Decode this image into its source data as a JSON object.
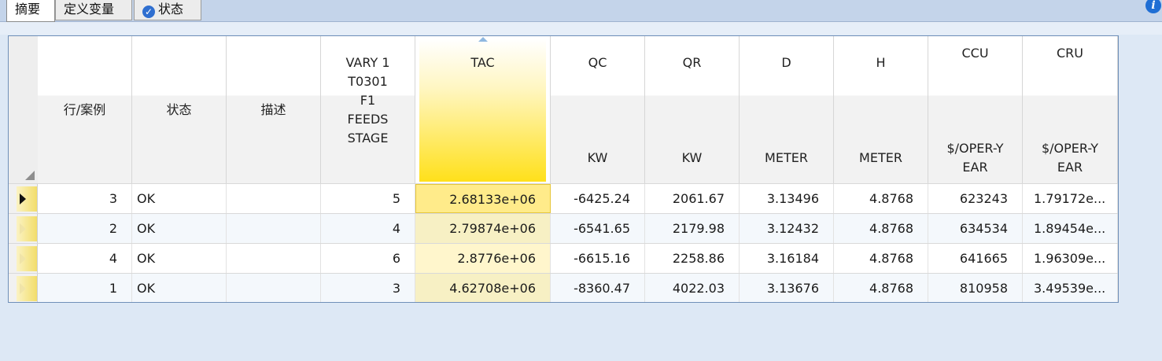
{
  "tabs": [
    {
      "label": "摘要",
      "active": true
    },
    {
      "label": "定义变量",
      "active": false
    },
    {
      "label": "状态",
      "active": false,
      "icon": "check-circle-icon"
    }
  ],
  "info_icon": "info-icon",
  "accent": {
    "tac_highlight": "#ffe01a",
    "border": "#6f8fb8",
    "tab_bg": "#c4d4ea"
  },
  "grid": {
    "columns": {
      "row_case": {
        "label": "行/案例"
      },
      "status": {
        "label": "状态"
      },
      "description": {
        "label": "描述"
      },
      "vary": {
        "lines": [
          "VARY   1",
          "T0301",
          "F1",
          "FEEDS",
          "STAGE"
        ]
      },
      "tac": {
        "label": "TAC",
        "unit": ""
      },
      "qc": {
        "label": "QC",
        "unit": "KW"
      },
      "qr": {
        "label": "QR",
        "unit": "KW"
      },
      "d": {
        "label": "D",
        "unit": "METER"
      },
      "h": {
        "label": "H",
        "unit": "METER"
      },
      "ccu": {
        "label": "CCU",
        "unit_lines": [
          "$/OPER-Y",
          "EAR"
        ]
      },
      "cru": {
        "label": "CRU",
        "unit_lines": [
          "$/OPER-Y",
          "EAR"
        ]
      }
    },
    "rows": [
      {
        "case": "3",
        "status": "OK",
        "desc": "",
        "vary": "5",
        "tac": "2.68133e+06",
        "qc": "-6425.24",
        "qr": "2061.67",
        "d": "3.13496",
        "h": "4.8768",
        "ccu": "623243",
        "cru": "1.79172e..."
      },
      {
        "case": "2",
        "status": "OK",
        "desc": "",
        "vary": "4",
        "tac": "2.79874e+06",
        "qc": "-6541.65",
        "qr": "2179.98",
        "d": "3.12432",
        "h": "4.8768",
        "ccu": "634534",
        "cru": "1.89454e..."
      },
      {
        "case": "4",
        "status": "OK",
        "desc": "",
        "vary": "6",
        "tac": "2.8776e+06",
        "qc": "-6615.16",
        "qr": "2258.86",
        "d": "3.16184",
        "h": "4.8768",
        "ccu": "641665",
        "cru": "1.96309e..."
      },
      {
        "case": "1",
        "status": "OK",
        "desc": "",
        "vary": "3",
        "tac": "4.62708e+06",
        "qc": "-8360.47",
        "qr": "4022.03",
        "d": "3.13676",
        "h": "4.8768",
        "ccu": "810958",
        "cru": "3.49539e..."
      }
    ]
  }
}
